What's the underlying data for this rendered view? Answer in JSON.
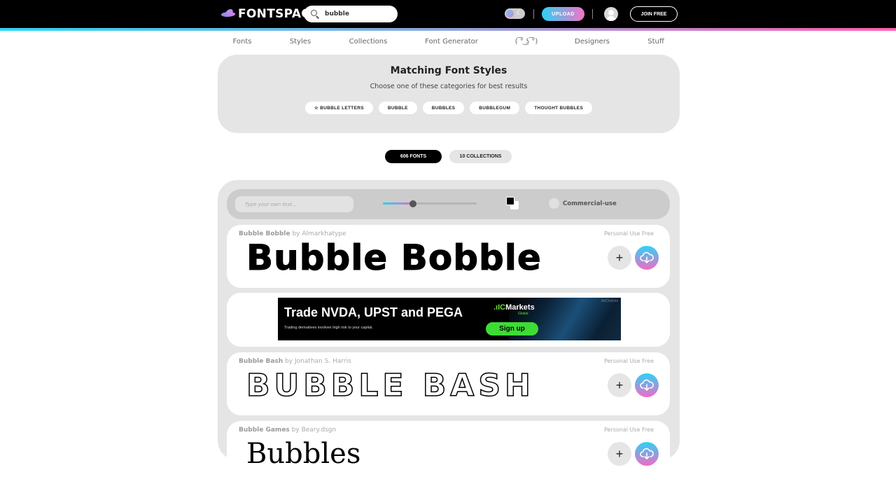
{
  "header": {
    "logo_text": "FONTSPACE",
    "search": {
      "value": "bubble",
      "placeholder": ""
    },
    "theme_toggle_icon": "moon-icon",
    "upload_label": "UPLOAD",
    "join_label": "JOIN FREE"
  },
  "nav": {
    "items": [
      {
        "label": "Fonts"
      },
      {
        "label": "Styles"
      },
      {
        "label": "Collections"
      },
      {
        "label": "Font Generator"
      },
      {
        "label": "( ͡° ͜ʖ ͡°)"
      },
      {
        "label": "Designers"
      },
      {
        "label": "Stuff"
      }
    ]
  },
  "matching": {
    "title": "Matching Font Styles",
    "subtitle": "Choose one of these categories for best results",
    "chips": [
      {
        "label": "☆ BUBBLE LETTERS"
      },
      {
        "label": "BUBBLE"
      },
      {
        "label": "BUBBLES"
      },
      {
        "label": "BUBBLEGUM"
      },
      {
        "label": "THOUGHT BUBBLES"
      }
    ]
  },
  "tabs": {
    "fonts": "606 FONTS",
    "collections": "10 COLLECTIONS"
  },
  "toolbar": {
    "text_placeholder": "Type your own text...",
    "size_slider_fraction": 0.32,
    "fg_color": "#000000",
    "bg_color": "#ffffff",
    "commercial_label": "Commercial-use"
  },
  "fonts": [
    {
      "name": "Bubble Bobble",
      "by": "by",
      "designer": "Almarkhatype",
      "license": "Personal Use Free",
      "preview": "Bubble Bobble"
    },
    {
      "name": "Bubble Bash",
      "by": "by",
      "designer": "Jonathan S. Harris",
      "license": "Personal Use Free",
      "preview": "BUBBLE BASH"
    },
    {
      "name": "Bubble Games",
      "by": "by",
      "designer": "Beary.dsgn",
      "license": "Personal Use Free",
      "preview": "Bubbles"
    }
  ],
  "ad": {
    "headline": "Trade NVDA, UPST and PEGA",
    "disclaimer": "Trading derivatives involves high risk to your capital.",
    "brand_prefix": ".ıIC",
    "brand_name": "Markets",
    "brand_sub": "Global",
    "cta": "Sign up",
    "choices": "AdChoices"
  },
  "colors": {
    "accent_gradient_start": "#29d7f4",
    "accent_gradient_end": "#ff5fb6",
    "panel_bg": "#e5e5e5",
    "toolbar_bg": "#cccccc"
  }
}
